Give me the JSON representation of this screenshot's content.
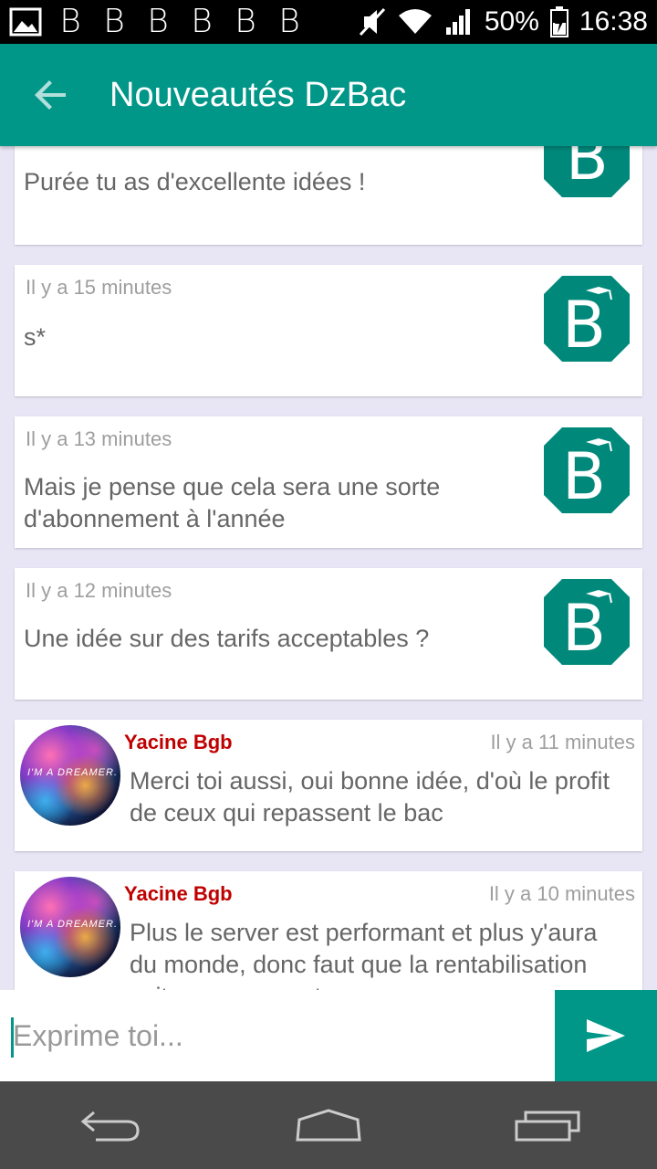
{
  "status_bar": {
    "notif_letters": [
      "B",
      "B",
      "B",
      "B",
      "B",
      "B"
    ],
    "battery": "50%",
    "time": "16:38"
  },
  "app_bar": {
    "title": "Nouveautés DzBac",
    "back_icon": "arrow-back-icon"
  },
  "messages": [
    {
      "time": "",
      "text": "Purée tu as d'excellente idées !",
      "sender": "dzbac"
    },
    {
      "time": "Il y a 15 minutes",
      "text": "s*",
      "sender": "dzbac"
    },
    {
      "time": "Il y a 13 minutes",
      "text": "Mais je pense que cela sera une sorte d'abonnement à l'année",
      "sender": "dzbac"
    },
    {
      "time": "Il y a 12 minutes",
      "text": "Une idée sur des tarifs acceptables ?",
      "sender": "dzbac"
    },
    {
      "author": "Yacine Bgb",
      "time": "Il y a 11 minutes",
      "text": "Merci toi aussi, oui bonne idée, d'où le profit de ceux qui repassent le bac",
      "avatar_text": "I'M A DREAMER."
    },
    {
      "author": "Yacine Bgb",
      "time": "Il y a 10 minutes",
      "text": "Plus le server est performant et plus y'aura du monde, donc faut que la rentabilisation soit assez correcte",
      "avatar_text": "I'M A DREAMER."
    }
  ],
  "input": {
    "placeholder": "Exprime toi..."
  },
  "colors": {
    "primary": "#009688",
    "author": "#c00000",
    "background": "#e8e6f5"
  }
}
